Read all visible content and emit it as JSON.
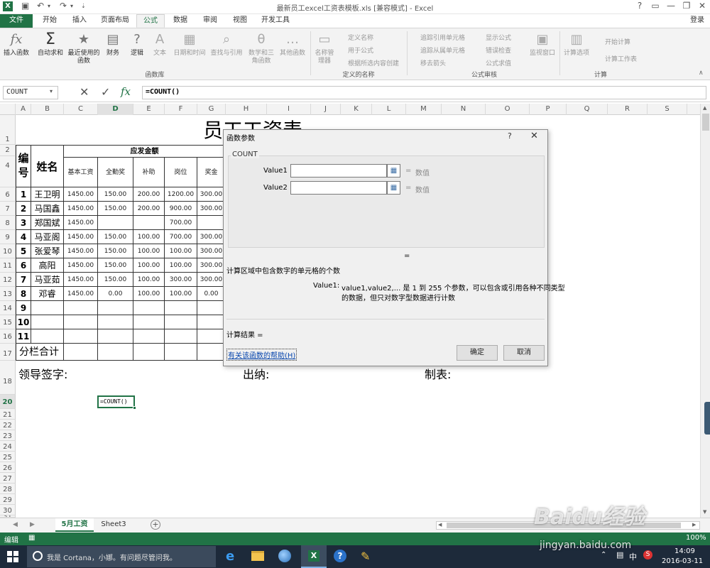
{
  "window": {
    "title": "最新员工excel工资表模板.xls  [兼容模式] - Excel",
    "help": "?",
    "login": "登录"
  },
  "tabs": [
    "文件",
    "开始",
    "插入",
    "页面布局",
    "公式",
    "数据",
    "审阅",
    "视图",
    "开发工具"
  ],
  "ribbon": {
    "large": [
      {
        "label": "插入函数",
        "icon": "fx"
      },
      {
        "label": "自动求和",
        "icon": "Σ"
      },
      {
        "label": "最近使用的函数",
        "icon": "★"
      },
      {
        "label": "财务",
        "icon": "▤"
      },
      {
        "label": "逻辑",
        "icon": "?"
      },
      {
        "label": "文本",
        "icon": "A"
      },
      {
        "label": "日期和时间",
        "icon": "▦"
      },
      {
        "label": "查找与引用",
        "icon": "⌕"
      },
      {
        "label": "数学和三角函数",
        "icon": "θ"
      },
      {
        "label": "其他函数",
        "icon": "…"
      },
      {
        "label": "名称管理器",
        "icon": "▭"
      },
      {
        "label": "监视窗口",
        "icon": "▣"
      },
      {
        "label": "计算选项",
        "icon": "▥"
      }
    ],
    "defined_names": [
      "定义名称",
      "用于公式",
      "根据所选内容创建"
    ],
    "audit": [
      "追踪引用单元格",
      "追踪从属单元格",
      "移去箭头",
      "显示公式",
      "错误检查",
      "公式求值"
    ],
    "calc": [
      "开始计算",
      "计算工作表"
    ],
    "groups": [
      "函数库",
      "定义的名称",
      "公式审核",
      "计算"
    ]
  },
  "formula_bar": {
    "name_box": "COUNT",
    "formula": "=COUNT()",
    "fx": "fx"
  },
  "columns": [
    "A",
    "B",
    "C",
    "D",
    "E",
    "F",
    "G",
    "H",
    "I",
    "J",
    "K",
    "L",
    "M",
    "N",
    "O",
    "P",
    "Q",
    "R",
    "S"
  ],
  "rows": [
    "1",
    "2",
    "4",
    "6",
    "7",
    "8",
    "9",
    "10",
    "11",
    "12",
    "13",
    "14",
    "15",
    "16",
    "17",
    "18",
    "20",
    "21",
    "22",
    "23",
    "24",
    "25",
    "26",
    "27",
    "28",
    "29",
    "30",
    "31"
  ],
  "sheet": {
    "title": "员工工资表",
    "header_no": "编号",
    "header_name": "姓名",
    "header_group": "应发金额",
    "sub_headers": [
      "基本工资",
      "全勤奖",
      "补助",
      "岗位",
      "奖金"
    ],
    "data": [
      [
        "1",
        "王卫明",
        "1450.00",
        "150.00",
        "200.00",
        "1200.00",
        "300.00"
      ],
      [
        "2",
        "马国鑫",
        "1450.00",
        "150.00",
        "200.00",
        "900.00",
        "300.00"
      ],
      [
        "3",
        "郑国斌",
        "1450.00",
        "",
        "",
        "700.00",
        ""
      ],
      [
        "4",
        "马亚阁",
        "1450.00",
        "150.00",
        "100.00",
        "700.00",
        "300.00"
      ],
      [
        "5",
        "张爱琴",
        "1450.00",
        "150.00",
        "100.00",
        "100.00",
        "300.00"
      ],
      [
        "6",
        "高阳",
        "1450.00",
        "150.00",
        "100.00",
        "100.00",
        "300.00"
      ],
      [
        "7",
        "马亚茹",
        "1450.00",
        "150.00",
        "100.00",
        "300.00",
        "300.00"
      ],
      [
        "8",
        "邓睿",
        "1450.00",
        "0.00",
        "100.00",
        "100.00",
        "0.00"
      ],
      [
        "9",
        "",
        "",
        "",
        "",
        "",
        ""
      ],
      [
        "10",
        "",
        "",
        "",
        "",
        "",
        ""
      ],
      [
        "11",
        "",
        "",
        "",
        "",
        "",
        ""
      ]
    ],
    "subtotal": "分栏合计",
    "sig_leader": "领导签字:",
    "sig_cashier": "出纳:",
    "sig_maker": "制表:",
    "active_cell": "=COUNT()"
  },
  "dialog": {
    "title": "函数参数",
    "func": "COUNT",
    "arg1": "Value1",
    "arg2": "Value2",
    "eq": "=",
    "hint": "数值",
    "result_eq": "=",
    "desc": "计算区域中包含数字的单元格的个数",
    "arg_name": "Value1:",
    "arg_desc_1": "value1,value2,... 是 1 到 255 个参数，可以包含或引用各种不同类型",
    "arg_desc_2": "的数据，但只对数字型数据进行计数",
    "calc_result": "计算结果 =",
    "help_link": "有关该函数的帮助(H)",
    "ok": "确定",
    "cancel": "取消"
  },
  "sheet_tabs": [
    "5月工资",
    "Sheet3"
  ],
  "status": {
    "mode": "编辑",
    "zoom": "100%"
  },
  "taskbar": {
    "search": "我是 Cortana，小娜。有问题尽管问我。",
    "time": "14:09",
    "date": "2016-03-11",
    "ime": "中"
  },
  "watermark": "Baidu经验",
  "watermark_url": "jingyan.baidu.com"
}
